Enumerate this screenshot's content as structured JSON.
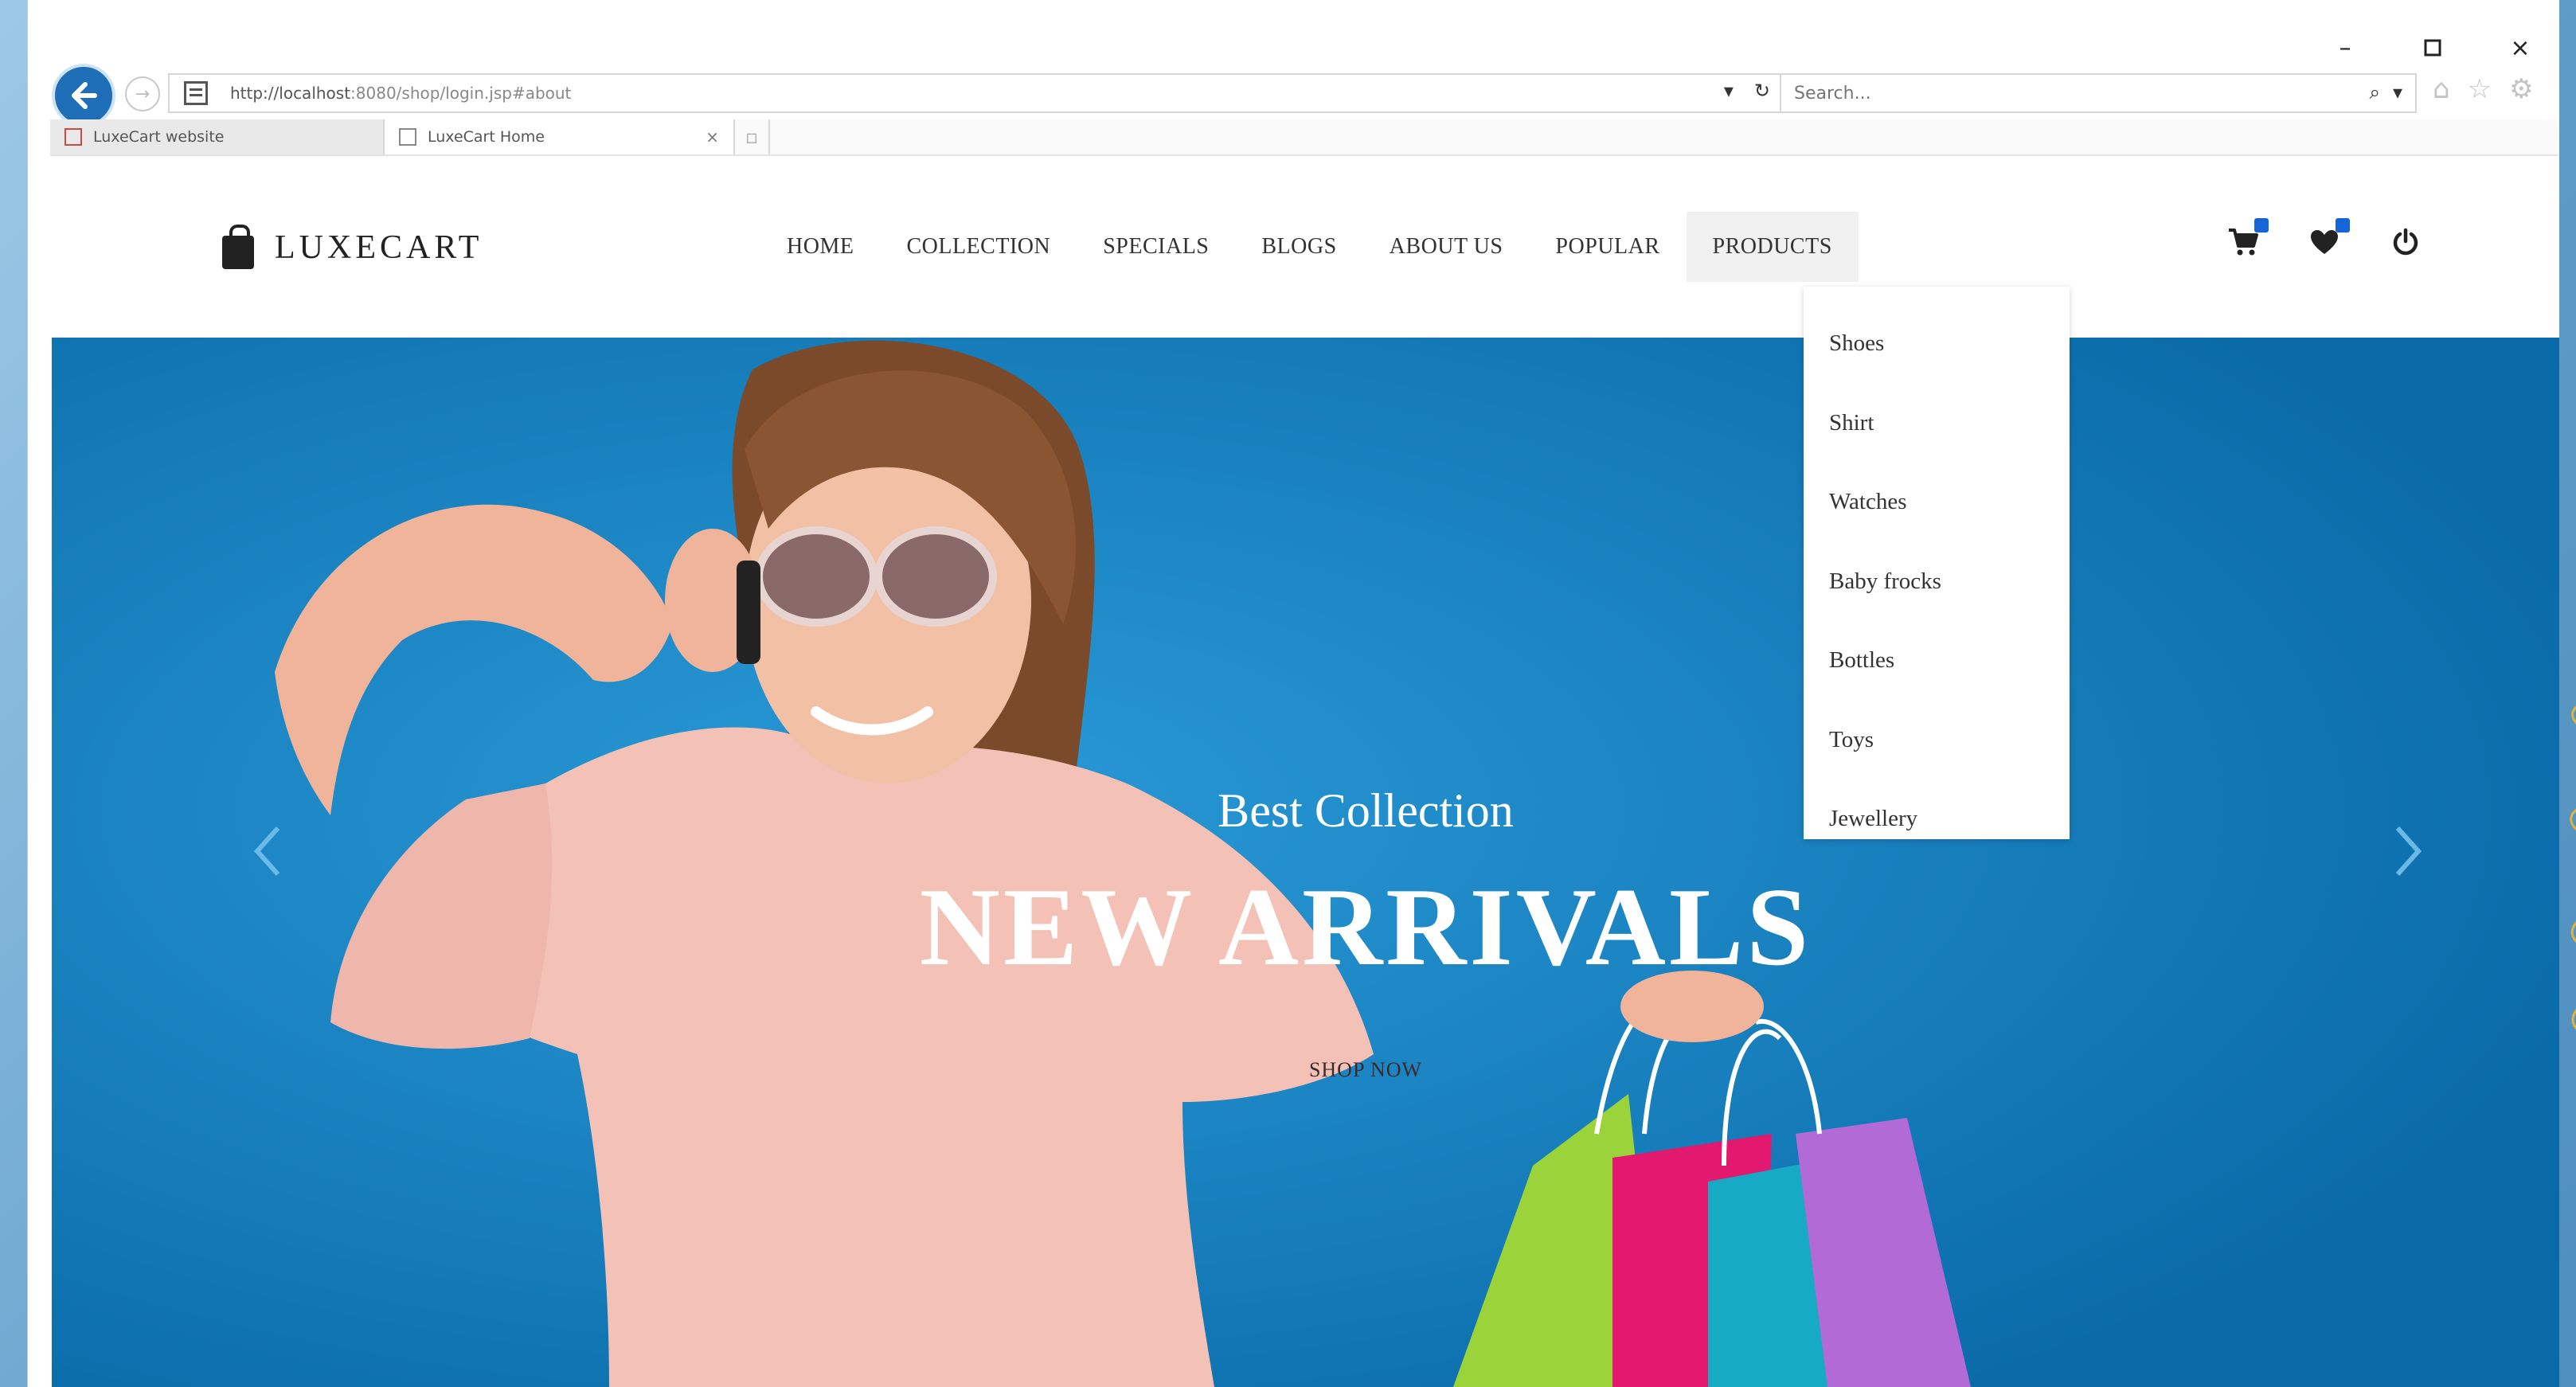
{
  "browser": {
    "url_host": "http://localhost",
    "url_rest": ":8080/shop/login.jsp#about",
    "search_placeholder": "Search...",
    "tabs": [
      {
        "label": "LuxeCart website",
        "active": false
      },
      {
        "label": "LuxeCart Home",
        "active": true
      }
    ],
    "icons": [
      "back-icon",
      "forward-icon",
      "refresh-icon",
      "search-icon",
      "home-icon",
      "star-icon",
      "gear-icon"
    ]
  },
  "site": {
    "brand": "LUXECART",
    "nav": [
      {
        "label": "HOME",
        "active": false
      },
      {
        "label": "COLLECTION",
        "active": false
      },
      {
        "label": "SPECIALS",
        "active": false
      },
      {
        "label": "BLOGS",
        "active": false
      },
      {
        "label": "ABOUT US",
        "active": false
      },
      {
        "label": "POPULAR",
        "active": false
      },
      {
        "label": "PRODUCTS",
        "active": true
      }
    ],
    "dropdown": [
      "Shoes",
      "Shirt",
      "Watches",
      "Baby frocks",
      "Bottles",
      "Toys",
      "Jewellery"
    ],
    "header_icons": [
      "cart-icon",
      "heart-icon",
      "power-icon"
    ],
    "accent_color": "#1565d8"
  },
  "hero": {
    "subtitle": "Best Collection",
    "title": "NEW ARRIVALS",
    "cta": "SHOP NOW",
    "background_color": "#1181c4"
  }
}
